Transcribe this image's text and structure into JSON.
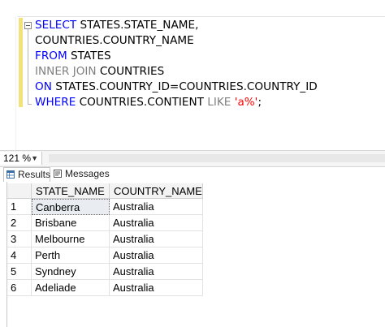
{
  "editor": {
    "lines": [
      {
        "tokens": [
          {
            "t": "SELECT",
            "c": "kw"
          },
          {
            "t": " STATES.STATE_NAME,",
            "c": ""
          }
        ]
      },
      {
        "tokens": [
          {
            "t": "COUNTRIES.COUNTRY_NAME",
            "c": ""
          }
        ]
      },
      {
        "tokens": [
          {
            "t": "FROM",
            "c": "kw"
          },
          {
            "t": " STATES",
            "c": ""
          }
        ]
      },
      {
        "tokens": [
          {
            "t": "INNER JOIN",
            "c": "gray"
          },
          {
            "t": " COUNTRIES",
            "c": ""
          }
        ]
      },
      {
        "tokens": [
          {
            "t": "ON",
            "c": "kw"
          },
          {
            "t": " STATES.COUNTRY_ID=COUNTRIES.COUNTRY_ID",
            "c": ""
          }
        ]
      },
      {
        "tokens": [
          {
            "t": "WHERE",
            "c": "kw"
          },
          {
            "t": " COUNTRIES.CONTIENT ",
            "c": ""
          },
          {
            "t": "LIKE",
            "c": "gray"
          },
          {
            "t": " ",
            "c": ""
          },
          {
            "t": "'a%'",
            "c": "str"
          },
          {
            "t": ";",
            "c": ""
          }
        ]
      }
    ]
  },
  "zoom": {
    "value": "121 %"
  },
  "tabs": {
    "results_label": "Results",
    "messages_label": "Messages"
  },
  "grid": {
    "columns": {
      "state": "STATE_NAME",
      "country": "COUNTRY_NAME"
    },
    "rows": [
      {
        "num": "1",
        "state": "Canberra",
        "country": "Australia"
      },
      {
        "num": "2",
        "state": "Brisbane",
        "country": "Australia"
      },
      {
        "num": "3",
        "state": "Melbourne",
        "country": "Australia"
      },
      {
        "num": "4",
        "state": "Perth",
        "country": "Australia"
      },
      {
        "num": "5",
        "state": "Syndney",
        "country": "Australia"
      },
      {
        "num": "6",
        "state": "Adeliade",
        "country": "Australia"
      }
    ]
  },
  "colors": {
    "keyword": "#0000ff",
    "operator": "#808080",
    "string": "#ff0000",
    "changebar": "#f3e27a"
  },
  "icons": {
    "results": "grid-icon",
    "messages": "messages-icon",
    "zoom_caret": "chevron-down-icon",
    "fold": "collapse-icon"
  }
}
